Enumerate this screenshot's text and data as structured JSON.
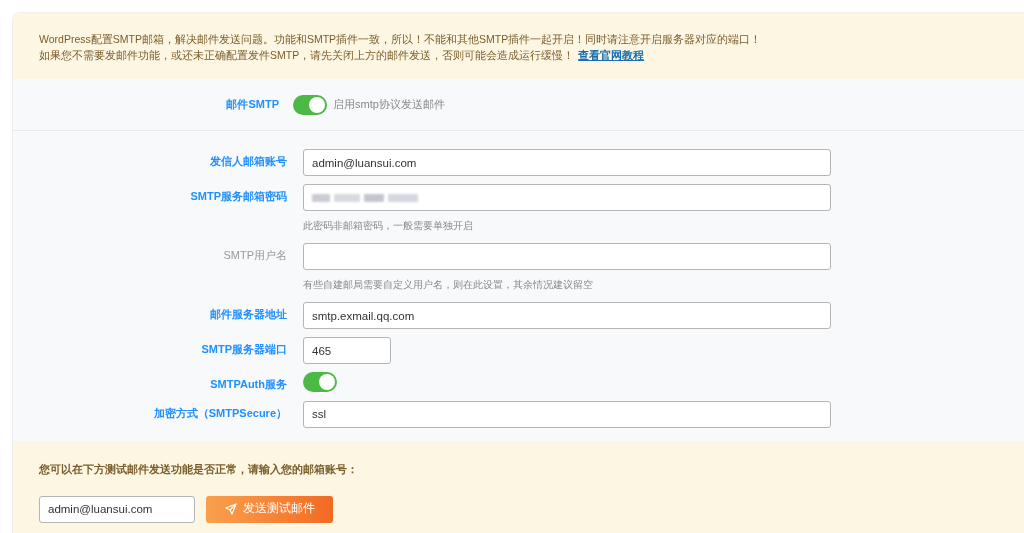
{
  "notice": {
    "lines": [
      "WordPress配置SMTP邮箱，解决邮件发送问题。功能和SMTP插件一致，所以！不能和其他SMTP插件一起开启！同时请注意开启服务器对应的端口！",
      "如果您不需要发邮件功能，或还未正确配置发件SMTP，请先关闭上方的邮件发送，否则可能会造成运行缓慢！"
    ],
    "link": "查看官网教程"
  },
  "smtp_switch": {
    "label": "邮件SMTP",
    "on": true,
    "description": "启用smtp协议发送邮件"
  },
  "fields": [
    {
      "kind": "text",
      "label": "发信人邮箱账号",
      "emphasized": true,
      "value": "admin@luansui.com"
    },
    {
      "kind": "blurred",
      "label": "SMTP服务邮箱密码",
      "emphasized": true,
      "hint": "此密码非邮箱密码，一般需要单独开启"
    },
    {
      "kind": "text",
      "label": "SMTP用户名",
      "emphasized": false,
      "hint": "有些自建邮局需要自定义用户名，则在此设置，其余情况建议留空"
    },
    {
      "kind": "text",
      "label": "邮件服务器地址",
      "emphasized": true,
      "value": "smtp.exmail.qq.com"
    },
    {
      "kind": "short_text",
      "label": "SMTP服务器端口",
      "emphasized": true,
      "value": "465"
    },
    {
      "kind": "toggle",
      "label": "SMTPAuth服务",
      "emphasized": true,
      "on": true
    },
    {
      "kind": "text",
      "label": "加密方式（SMTPSecure）",
      "emphasized": true,
      "value": "ssl"
    }
  ],
  "test": {
    "prompt": "您可以在下方测试邮件发送功能是否正常，请输入您的邮箱账号：",
    "email": "admin@luansui.com",
    "button": "发送测试邮件"
  }
}
